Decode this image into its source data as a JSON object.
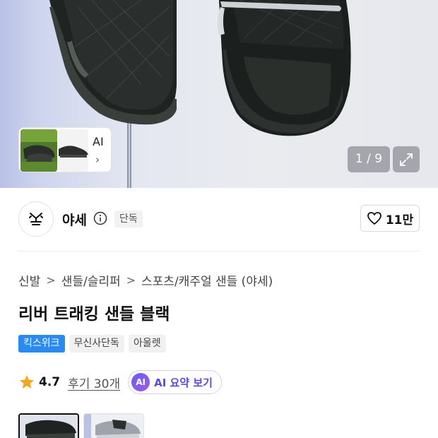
{
  "gallery": {
    "ai_label": "AI",
    "ai_chevron": "›",
    "counter": "1 / 9",
    "expand_icon": "expand-icon",
    "image_subject": "black trekking sandal"
  },
  "brand": {
    "name": "야세",
    "logo_text": "Y.S",
    "info_icon": "info-icon",
    "exclusive_badge": "단독",
    "like_icon": "heart-icon",
    "like_count": "11만"
  },
  "breadcrumb": {
    "items": [
      "신발",
      "샌들/슬리퍼",
      "스포츠/캐주얼 샌들 (야세)"
    ],
    "separator": ">"
  },
  "product": {
    "title": "리버 트래킹 샌들 블랙",
    "tags": [
      "킥스위크",
      "무신사단독",
      "아울렛"
    ],
    "rating": "4.7",
    "review_label": "후기 30개",
    "ai_summary_badge": "AI",
    "ai_summary_label": "AI 요약 보기"
  },
  "colors": {
    "accent_blue": "#2b8aef",
    "star": "#f5a623",
    "ai_purple": "#6d5cf0"
  }
}
